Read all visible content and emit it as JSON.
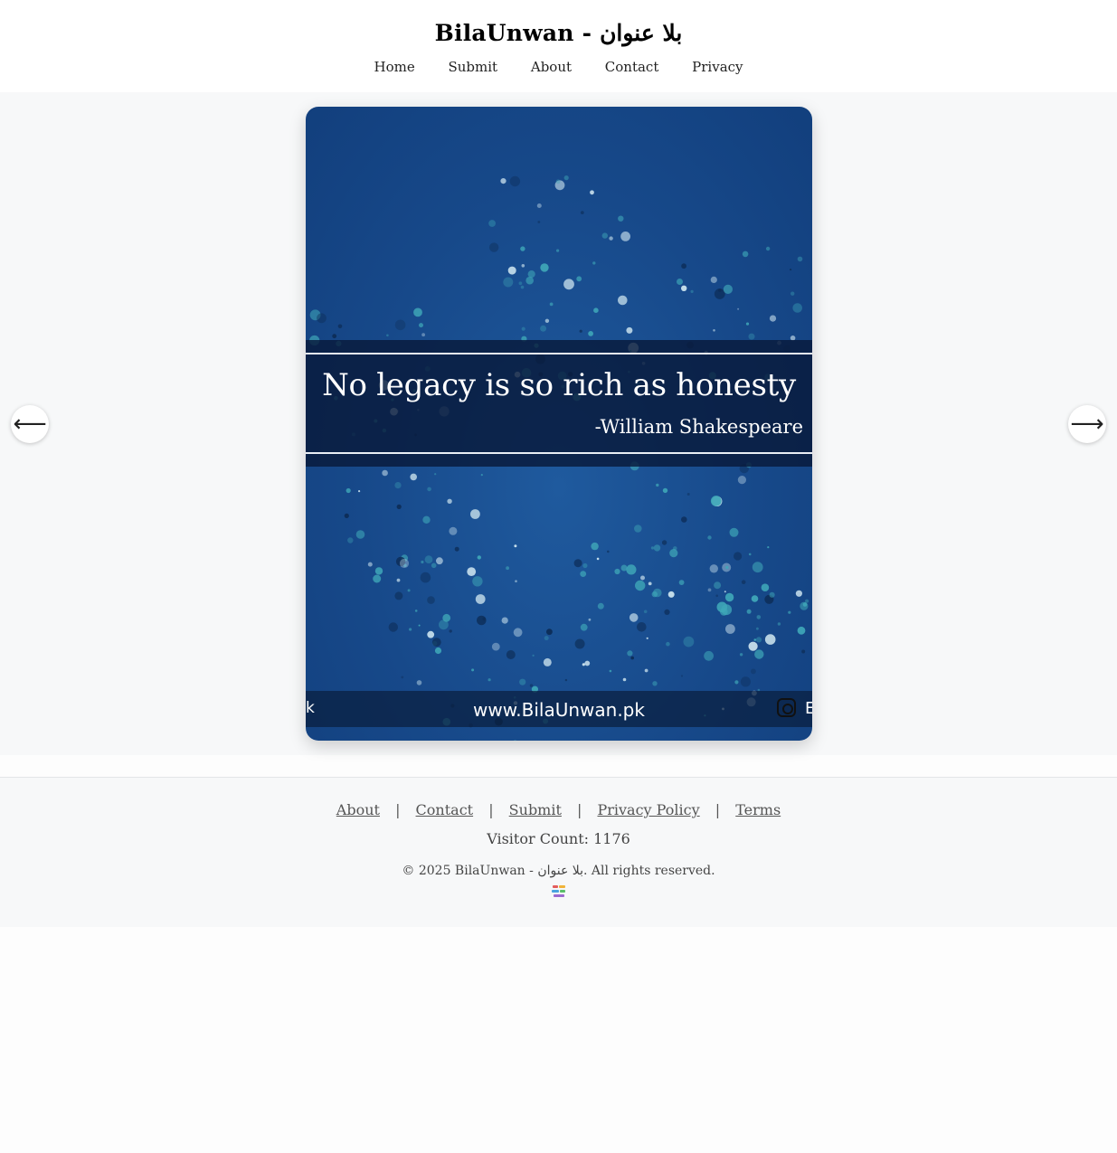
{
  "site": {
    "title": "BilaUnwan - بلا عنوان"
  },
  "nav": [
    {
      "label": "Home"
    },
    {
      "label": "Submit"
    },
    {
      "label": "About"
    },
    {
      "label": "Contact"
    },
    {
      "label": "Privacy"
    }
  ],
  "gallery": {
    "quote": "No legacy is so rich as honesty",
    "author": "-William Shakespeare",
    "website": "www.BilaUnwan.pk",
    "url_left_fragment": "k",
    "url_right_fragment": "E",
    "prev_label": "⟵",
    "next_label": "⟶",
    "icons": {
      "social": "instagram-icon"
    },
    "colors": {
      "background": "#17498a",
      "banner": "#081a3a"
    }
  },
  "footer": {
    "links": [
      "About",
      "Contact",
      "Submit",
      "Privacy Policy",
      "Terms"
    ],
    "separator": "|",
    "visitor_count": "Visitor Count: 1176",
    "copyright": "© 2025 BilaUnwan - بلا عنوان. All rights reserved."
  }
}
